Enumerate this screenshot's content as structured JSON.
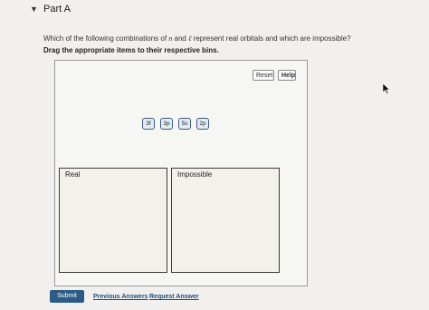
{
  "part": {
    "title": "Part A"
  },
  "question": {
    "before_n": "Which of the following combinations of ",
    "n": "n",
    "mid": " and ",
    "l": "ℓ",
    "after": " represent real orbitals and which are impossible?"
  },
  "instruction": "Drag the appropriate items to their respective bins.",
  "toolbar": {
    "reset": "Reset",
    "help": "Help"
  },
  "items": [
    "3f",
    "3p",
    "5s",
    "2p"
  ],
  "bins": {
    "real": "Real",
    "impossible": "Impossible"
  },
  "actions": {
    "submit": "Submit",
    "previous_answers": "Previous Answers",
    "request_answer": "Request Answer"
  },
  "colors": {
    "submit_bg": "#2c5c86",
    "chip_border": "#3b5b86",
    "chip_bg": "#e3ecf3",
    "link": "#1f4d7a"
  }
}
